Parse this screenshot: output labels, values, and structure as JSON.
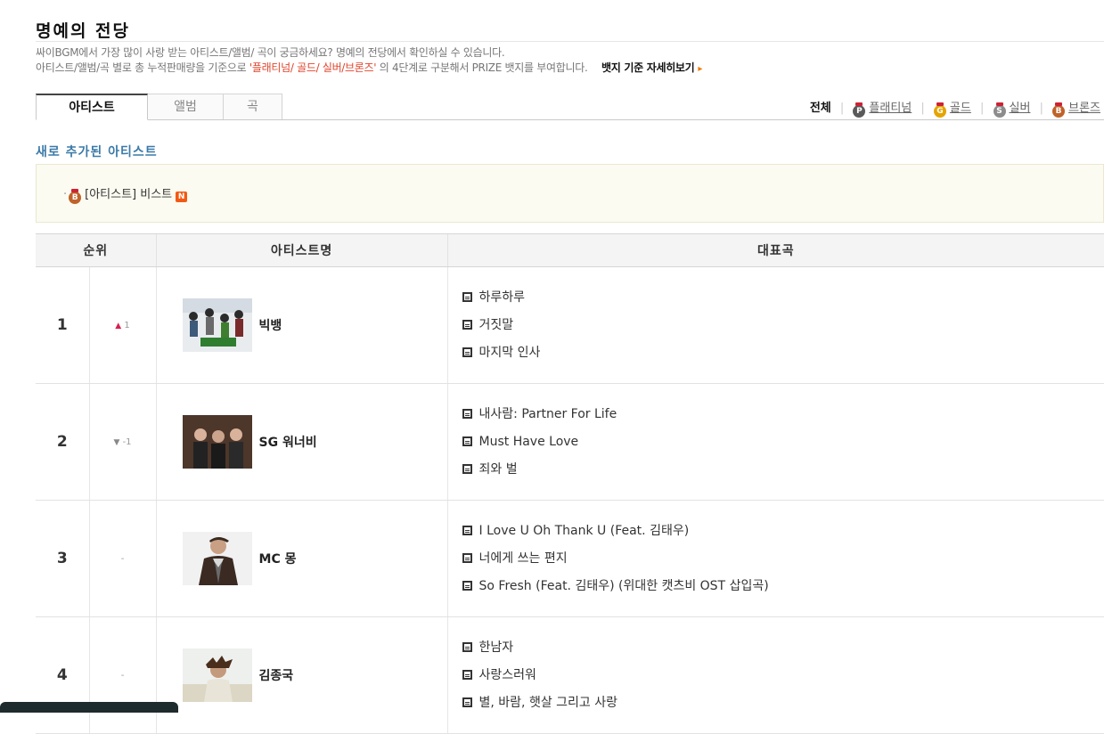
{
  "page": {
    "title": "명예의 전당",
    "desc_line1": "싸이BGM에서 가장 많이 사랑 받는 아티스트/앨범/ 곡이 궁금하세요? 명예의 전당에서 확인하실 수 있습니다.",
    "desc_line2_pre": "아티스트/앨범/곡 별로 총 누적판매량을 기준으로 ",
    "desc_line2_hl": "'플래티넘/ 골드/ 실버/브론즈'",
    "desc_line2_post": " 의 4단계로 구분해서 PRIZE 뱃지를 부여합니다.",
    "badge_info_link": "뱃지 기준 자세히보기",
    "badge_info_arrow": "▸"
  },
  "tabs": [
    "아티스트",
    "앨범",
    "곡"
  ],
  "filters": {
    "all": "전체",
    "items": [
      {
        "label": "플래티넘",
        "medal": "P",
        "color": "#5a5a5a"
      },
      {
        "label": "골드",
        "medal": "G",
        "color": "#e5a400"
      },
      {
        "label": "실버",
        "medal": "S",
        "color": "#8c8c8c"
      },
      {
        "label": "브론즈",
        "medal": "B",
        "color": "#c0622a"
      }
    ]
  },
  "new_section": {
    "title": "새로 추가된 아티스트",
    "bullet": "·",
    "item": "[아티스트] 비스트",
    "badge": "N"
  },
  "table": {
    "headers": [
      "순위",
      "아티스트명",
      "대표곡"
    ],
    "rows": [
      {
        "rank": "1",
        "change_icon": "▲",
        "change": "1",
        "artist": "빅뱅",
        "thumb": "bigbang-photo",
        "songs": [
          "하루하루",
          "거짓말",
          "마지막 인사"
        ]
      },
      {
        "rank": "2",
        "change_icon": "▼",
        "change": "-1",
        "artist": "SG 워너비",
        "thumb": "sg-wannabe-photo",
        "songs": [
          "내사람: Partner For Life",
          "Must Have Love",
          "죄와 벌"
        ]
      },
      {
        "rank": "3",
        "change_icon": "",
        "change": "-",
        "artist": "MC 몽",
        "thumb": "mc-mong-photo",
        "songs": [
          "I Love U Oh Thank U (Feat. 김태우)",
          "너에게 쓰는 편지",
          "So Fresh (Feat. 김태우) (위대한 캣츠비 OST 삽입곡)"
        ]
      },
      {
        "rank": "4",
        "change_icon": "",
        "change": "-",
        "artist": "김종국",
        "thumb": "kim-jongkook-photo",
        "songs": [
          "한남자",
          "사랑스러워",
          "별, 바람, 햇살 그리고 사랑"
        ]
      }
    ]
  }
}
